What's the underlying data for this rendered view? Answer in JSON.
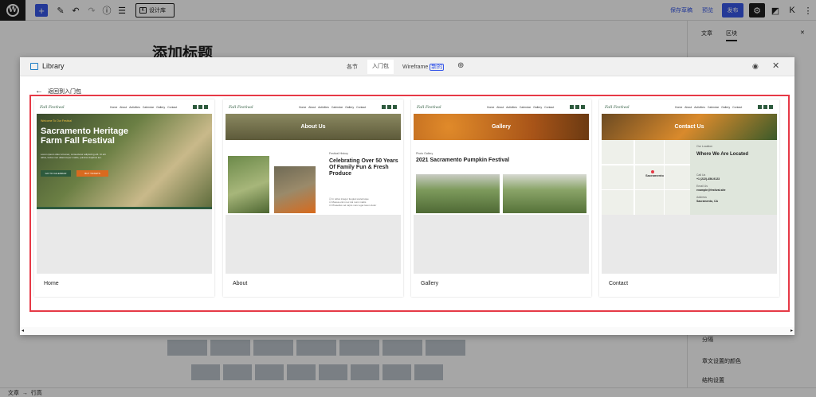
{
  "editor": {
    "library_label": "设计库",
    "save_draft": "保存草稿",
    "preview": "预览",
    "publish": "发布",
    "post_title": "添加标题",
    "breadcrumb": [
      "文章",
      "行高"
    ]
  },
  "sidebar": {
    "tabs": [
      "文章",
      "区块"
    ],
    "rows": [
      "分隔",
      "章文设置的颜色",
      "结构设置"
    ]
  },
  "modal": {
    "title": "Library",
    "tabs": [
      "各节",
      "入门包",
      "Wireframe"
    ],
    "new_badge": "新的",
    "back_link": "返回到入门包",
    "cards": [
      {
        "label": "Home"
      },
      {
        "label": "About"
      },
      {
        "label": "Gallery"
      },
      {
        "label": "Contact"
      }
    ]
  },
  "thumbnails": {
    "logo": "Fall Festival",
    "nav": [
      "Home",
      "About",
      "Activities",
      "Calendar",
      "Gallery",
      "Contact"
    ],
    "home": {
      "welcome": "Welcome To Our Festival",
      "title": "Sacramento Heritage Farm Fall Festival",
      "text": "Lorem ipsum dolor sit amet, consectetur adipiscing elit. Ut elit tellus, luctus nec ullamcorper mattis, pulvinar dapibus leo.",
      "button1": "GO TO CALENDAR",
      "button2": "BUY TICKETS"
    },
    "about": {
      "banner": "About Us",
      "eyebrow": "Festival History",
      "title": "Celebrating Over 50 Years Of Family Fun & Fresh Produce",
      "list": [
        "In tellus integer feugiat scelerisque",
        "Massa enim nec dui nunc mattis",
        "Phasellus vel turpis nunc eget lorem dolor"
      ]
    },
    "gallery": {
      "banner": "Gallery",
      "eyebrow": "Photo Gallery",
      "title": "2021 Sacramento Pumpkin Festival"
    },
    "contact": {
      "banner": "Contact Us",
      "eyebrow": "Our Location",
      "title": "Where We Are Located",
      "call_label": "Call Us",
      "phone": "+1 (222)-456-9123",
      "email_label": "Email Us",
      "email": "example@festival.site",
      "address_label": "Address",
      "address": "Sacramento, CA",
      "map_city": "Sacramento"
    }
  },
  "colors": {
    "accent": "#3858e9",
    "frame": "#e63946",
    "brand_green": "#2d5a3d",
    "brand_orange": "#d96a1f"
  }
}
